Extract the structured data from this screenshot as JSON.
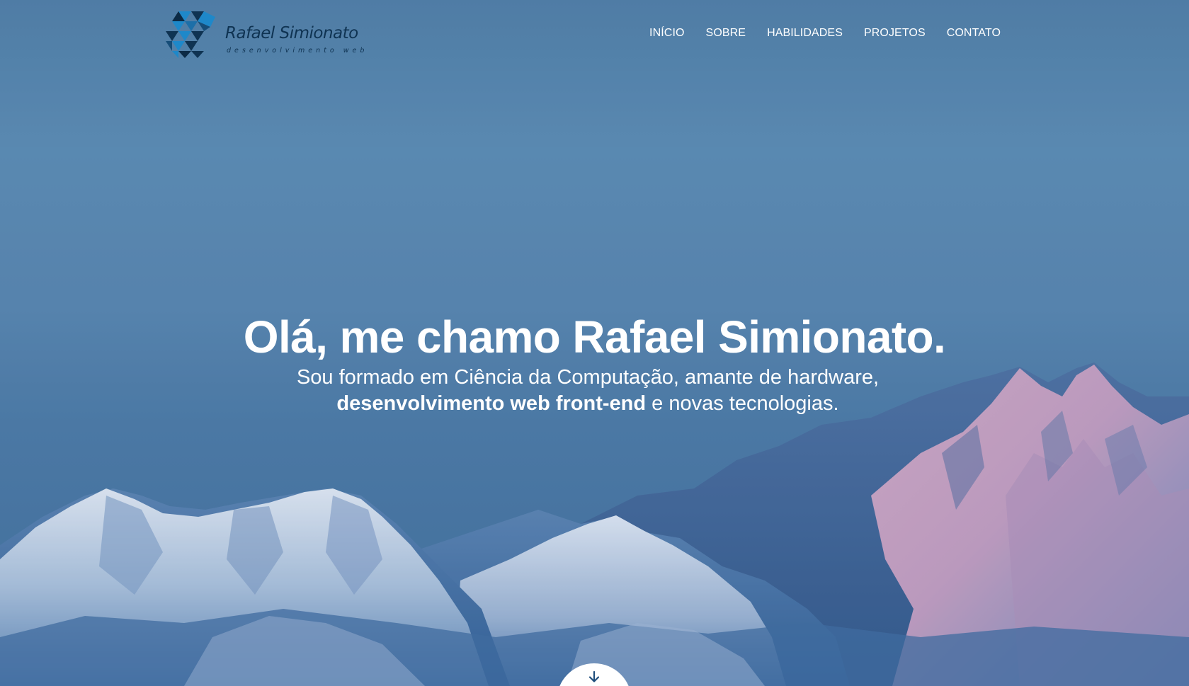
{
  "header": {
    "logo": {
      "title": "Rafael Simionato",
      "subtitle": "desenvolvimento web"
    },
    "nav": [
      {
        "label": "INÍCIO"
      },
      {
        "label": "SOBRE"
      },
      {
        "label": "HABILIDADES"
      },
      {
        "label": "PROJETOS"
      },
      {
        "label": "CONTATO"
      }
    ]
  },
  "hero": {
    "headline": "Olá, me chamo Rafael Simionato.",
    "subline_part1": "Sou formado em Ciência da Computação, amante de hardware,",
    "subline_bold": "desenvolvimento web front-end",
    "subline_part2": " e novas tecnologias.",
    "scroll_icon": "arrow-down-icon"
  },
  "colors": {
    "sky": "#5b8bb2",
    "logo_text": "#0f3352",
    "logo_accent": "#1e88c9",
    "text": "#ffffff"
  }
}
